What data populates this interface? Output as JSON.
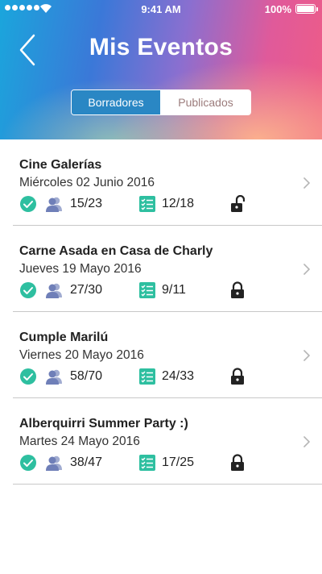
{
  "status_bar": {
    "time": "9:41 AM",
    "battery": "100%"
  },
  "header": {
    "title": "Mis Eventos",
    "back_icon": "chevron-left-icon"
  },
  "segments": {
    "drafts": "Borradores",
    "published": "Publicados",
    "selected": "Borradores"
  },
  "colors": {
    "accent": "#2a87c4",
    "check": "#2ebfa0",
    "people": "#6f7fb8",
    "list_icon": "#2ebfa0",
    "lock": "#222222"
  },
  "events": [
    {
      "title": "Cine Galerías",
      "date": "Miércoles 02 Junio 2016",
      "attendees": "15/23",
      "tasks": "12/18",
      "locked": false
    },
    {
      "title": "Carne Asada en Casa de Charly",
      "date": "Jueves 19 Mayo 2016",
      "attendees": "27/30",
      "tasks": "9/11",
      "locked": true
    },
    {
      "title": "Cumple Marilú",
      "date": "Viernes 20 Mayo 2016",
      "attendees": "58/70",
      "tasks": "24/33",
      "locked": true
    },
    {
      "title": "Alberquirri Summer Party :)",
      "date": "Martes 24 Mayo 2016",
      "attendees": "38/47",
      "tasks": "17/25",
      "locked": true
    }
  ]
}
